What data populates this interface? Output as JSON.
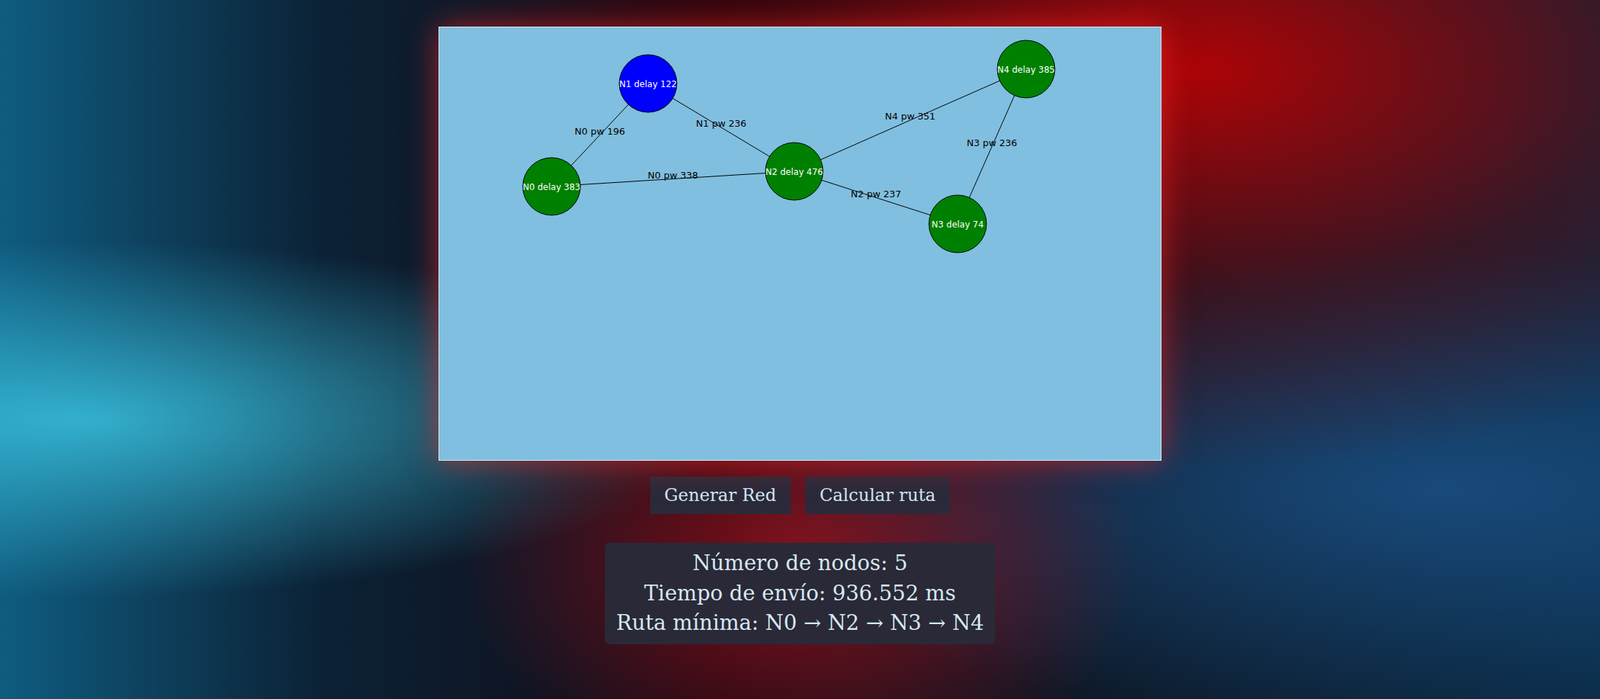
{
  "canvas": {
    "nodes": [
      {
        "label": "N0 delay 383",
        "color": "#008000"
      },
      {
        "label": "N1 delay 122",
        "color": "#0000ff"
      },
      {
        "label": "N2 delay 476",
        "color": "#008000"
      },
      {
        "label": "N3 delay 74",
        "color": "#008000"
      },
      {
        "label": "N4 delay 385",
        "color": "#008000"
      }
    ],
    "edges": [
      {
        "from": 0,
        "to": 1,
        "label": "N0 pw 196"
      },
      {
        "from": 1,
        "to": 2,
        "label": "N1 pw 236"
      },
      {
        "from": 0,
        "to": 2,
        "label": "N0 pw 338"
      },
      {
        "from": 2,
        "to": 4,
        "label": "N4 pw 351"
      },
      {
        "from": 2,
        "to": 3,
        "label": "N2 pw 237"
      },
      {
        "from": 3,
        "to": 4,
        "label": "N3 pw 236"
      }
    ]
  },
  "buttons": [
    "Generar Red",
    "Calcular ruta"
  ],
  "info": [
    "Número de nodos: 5",
    "Tiempo de envío: 936.552 ms",
    "Ruta mínima: N0 → N2 → N3 → N4"
  ]
}
